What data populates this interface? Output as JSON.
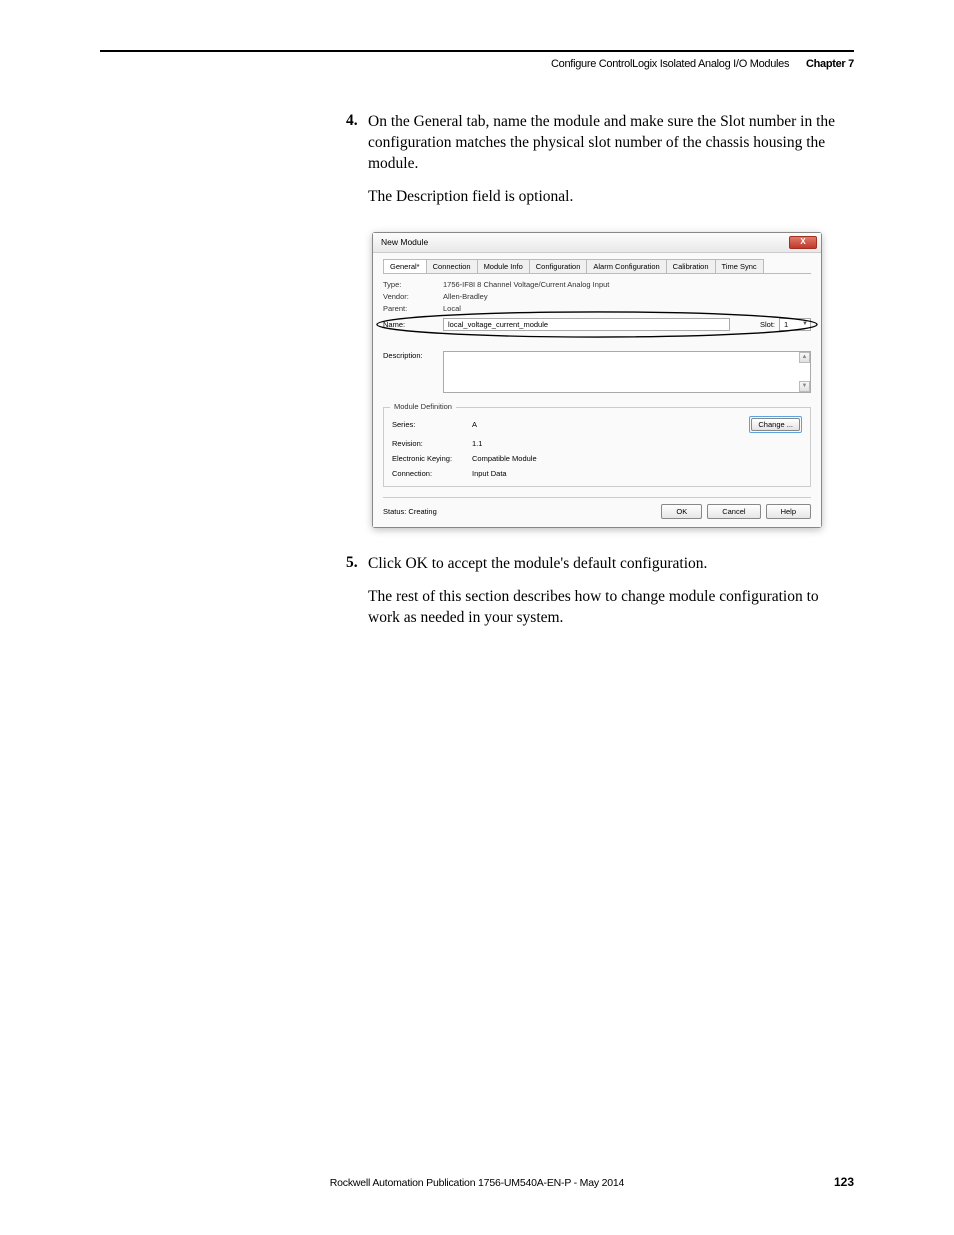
{
  "header": {
    "title": "Configure ControlLogix Isolated Analog I/O Modules",
    "chapter": "Chapter 7"
  },
  "step4": {
    "num": "4.",
    "text": "On the General tab, name the module and make sure the Slot number in the configuration matches the physical slot number of the chassis housing the module.",
    "sub": "The Description field is optional."
  },
  "dialog": {
    "title": "New Module",
    "close": "X",
    "tabs": [
      "General*",
      "Connection",
      "Module Info",
      "Configuration",
      "Alarm Configuration",
      "Calibration",
      "Time Sync"
    ],
    "rows": {
      "type_label": "Type:",
      "type_value": "1756-IF8I 8 Channel Voltage/Current Analog Input",
      "vendor_label": "Vendor:",
      "vendor_value": "Allen-Bradley",
      "parent_label": "Parent:",
      "parent_value": "Local",
      "name_label": "Name:",
      "name_value": "local_voltage_current_module",
      "slot_label": "Slot:",
      "slot_value": "1",
      "desc_label": "Description:"
    },
    "moddef": {
      "legend": "Module Definition",
      "series_label": "Series:",
      "series_value": "A",
      "revision_label": "Revision:",
      "revision_value": "1.1",
      "keying_label": "Electronic Keying:",
      "keying_value": "Compatible Module",
      "connection_label": "Connection:",
      "connection_value": "Input Data",
      "change_btn": "Change ..."
    },
    "status": "Status: Creating",
    "buttons": {
      "ok": "OK",
      "cancel": "Cancel",
      "help": "Help"
    }
  },
  "step5": {
    "num": "5.",
    "text": "Click OK to accept the module's default configuration.",
    "sub": "The rest of this section describes how to change module configuration to work as needed in your system."
  },
  "footer": {
    "pub": "Rockwell Automation Publication 1756-UM540A-EN-P - May 2014",
    "page": "123"
  }
}
